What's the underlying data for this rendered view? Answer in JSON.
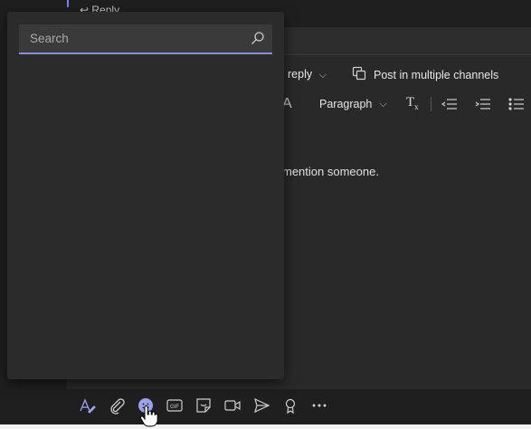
{
  "top": {
    "reply_label": "↩ Reply"
  },
  "compose": {
    "reply_choice": "reply",
    "post_multi": "Post in multiple channels",
    "paragraph": "Paragraph",
    "placeholder_tail": "mention someone."
  },
  "popup": {
    "search_placeholder": "Search"
  },
  "colors": {
    "accent": "#7b83eb",
    "popup_bg": "#2b2b2b",
    "compose_bg": "#292929"
  },
  "bottom_icons": [
    "format-icon",
    "attach-icon",
    "emoji-icon",
    "gif-icon",
    "sticker-icon",
    "meet-icon",
    "send-icon",
    "praise-icon",
    "more-icon"
  ]
}
